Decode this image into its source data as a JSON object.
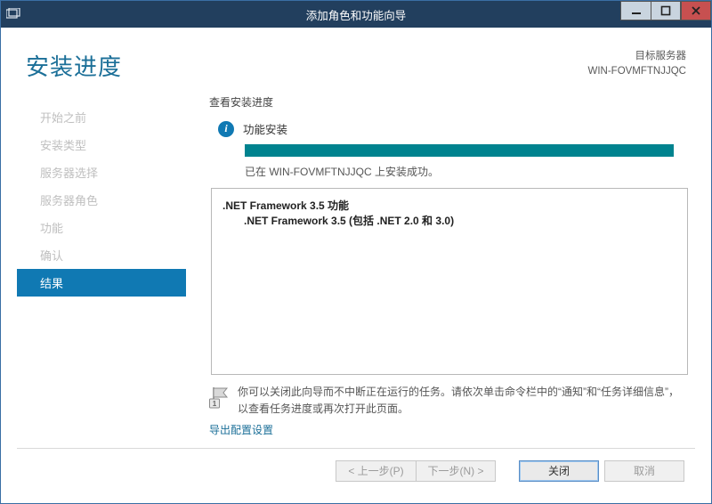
{
  "window": {
    "title": "添加角色和功能向导"
  },
  "header": {
    "page_title": "安装进度",
    "target_label": "目标服务器",
    "target_name": "WIN-FOVMFTNJJQC"
  },
  "sidebar": {
    "steps": [
      {
        "label": "开始之前",
        "active": false
      },
      {
        "label": "安装类型",
        "active": false
      },
      {
        "label": "服务器选择",
        "active": false
      },
      {
        "label": "服务器角色",
        "active": false
      },
      {
        "label": "功能",
        "active": false
      },
      {
        "label": "确认",
        "active": false
      },
      {
        "label": "结果",
        "active": true
      }
    ]
  },
  "main": {
    "section_label": "查看安装进度",
    "status_text": "功能安装",
    "result_line": "已在 WIN-FOVMFTNJJQC 上安装成功。",
    "features": {
      "line1": ".NET Framework 3.5 功能",
      "line2": ".NET Framework 3.5 (包括 .NET 2.0 和 3.0)"
    },
    "note_text": "你可以关闭此向导而不中断正在运行的任务。请依次单击命令栏中的“通知”和“任务详细信息”，以查看任务进度或再次打开此页面。",
    "export_link": "导出配置设置"
  },
  "footer": {
    "prev": "< 上一步(P)",
    "next": "下一步(N) >",
    "close": "关闭",
    "cancel": "取消"
  }
}
